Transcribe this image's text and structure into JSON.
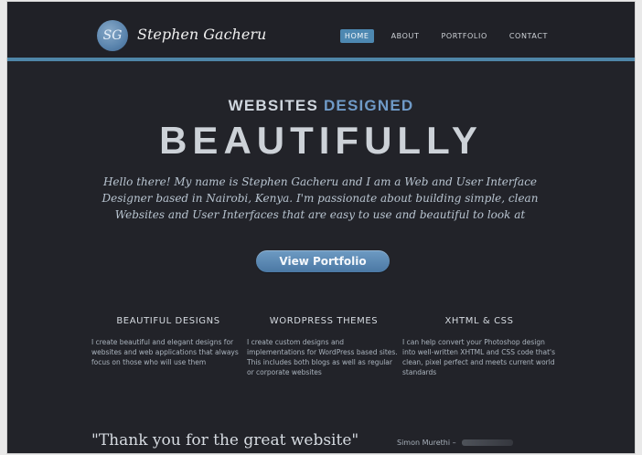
{
  "header": {
    "logo_mark": "SG",
    "brand": "Stephen Gacheru",
    "nav": [
      "HOME",
      "ABOUT",
      "PORTFOLIO",
      "CONTACT"
    ],
    "active_nav": "HOME",
    "accent_color": "#4f86a8"
  },
  "hero": {
    "kicker_plain": "WEBSITES",
    "kicker_accent": "DESIGNED",
    "headline": "BEAUTIFULLY",
    "intro": "Hello there! My name is Stephen Gacheru and I am a Web and User Interface Designer based in Nairobi, Kenya. I'm passionate about building simple, clean Websites and User Interfaces that are easy to use and beautiful to look at",
    "cta_label": "View Portfolio"
  },
  "features": [
    {
      "title": "BEAUTIFUL DESIGNS",
      "text": "I create beautiful and elegant designs for websites and web applications that always focus on those who will use them"
    },
    {
      "title": "WORDPRESS THEMES",
      "text": "I create custom designs and implementations for WordPress based sites. This includes both blogs as well as regular or corporate websites"
    },
    {
      "title": "XHTML & CSS",
      "text": "I can help convert your Photoshop design into well-written XHTML and CSS code that's clean, pixel perfect and meets current world standards"
    }
  ],
  "testimonial": {
    "quote": "\"Thank you for the great website\"",
    "author": "Simon Murethi –"
  }
}
